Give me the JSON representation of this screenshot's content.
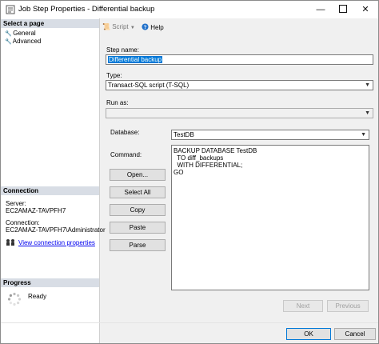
{
  "window": {
    "title": "Job Step Properties - Differential backup",
    "minimize": "—",
    "close": "✕"
  },
  "left": {
    "select_page_header": "Select a page",
    "pages": [
      "General",
      "Advanced"
    ],
    "connection_header": "Connection",
    "server_label": "Server:",
    "server_value": "EC2AMAZ-TAVPFH7",
    "connection_label": "Connection:",
    "connection_value": "EC2AMAZ-TAVPFH7\\Administrator",
    "view_connection_link": "View connection properties",
    "progress_header": "Progress",
    "progress_status": "Ready"
  },
  "toolbar": {
    "script_label": "Script",
    "help_label": "Help"
  },
  "form": {
    "step_name_label": "Step name:",
    "step_name_value": "Differential backup",
    "type_label": "Type:",
    "type_value": "Transact-SQL script (T-SQL)",
    "run_as_label": "Run as:",
    "run_as_value": "",
    "database_label": "Database:",
    "database_value": "TestDB",
    "command_label": "Command:",
    "command_lines": [
      "BACKUP DATABASE TestDB",
      "  TO diff_backups",
      "  WITH DIFFERENTIAL;",
      "GO"
    ]
  },
  "buttons": {
    "open": "Open...",
    "select_all": "Select All",
    "copy": "Copy",
    "paste": "Paste",
    "parse": "Parse",
    "next": "Next",
    "previous": "Previous",
    "ok": "OK",
    "cancel": "Cancel"
  },
  "colors": {
    "selection": "#0078d7",
    "link": "#0000ee",
    "section_header": "#d8dde5"
  }
}
